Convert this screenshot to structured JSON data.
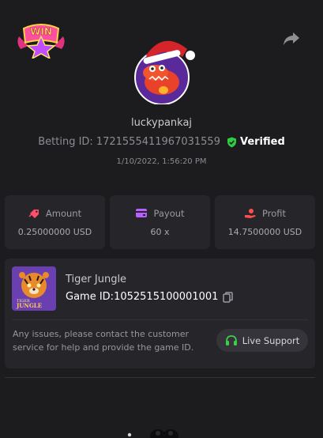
{
  "header": {
    "badge_text": "WIN",
    "share_icon": "share-arrow-icon"
  },
  "profile": {
    "username": "luckypankaj",
    "betting_id_label": "Betting ID:",
    "betting_id": "1721555411967031559",
    "verified_label": "Verified",
    "timestamp": "1/10/2022, 1:56:20 PM"
  },
  "stats": [
    {
      "label": "Amount",
      "value": "0.25000000 USD",
      "icon": "amount-tag-icon",
      "color": "#ff4d6a"
    },
    {
      "label": "Payout",
      "value": "60 x",
      "icon": "wallet-card-icon",
      "color": "#b660ff"
    },
    {
      "label": "Profit",
      "value": "14.7500000 USD",
      "icon": "profit-hand-icon",
      "color": "#ff4d4d"
    }
  ],
  "game": {
    "name": "Tiger Jungle",
    "id_label": "Game ID:",
    "id_value": "1052515100001001",
    "thumb_caption_small": "TIGER",
    "thumb_caption_big": "JUNGLE",
    "issue_text": "Any issues, please contact the customer service for help and provide the game ID.",
    "support_label": "Live Support"
  },
  "colors": {
    "background": "#1c1c1f",
    "card": "#26262a",
    "verified_green": "#2ecc40",
    "support_green": "#3cd04a"
  }
}
